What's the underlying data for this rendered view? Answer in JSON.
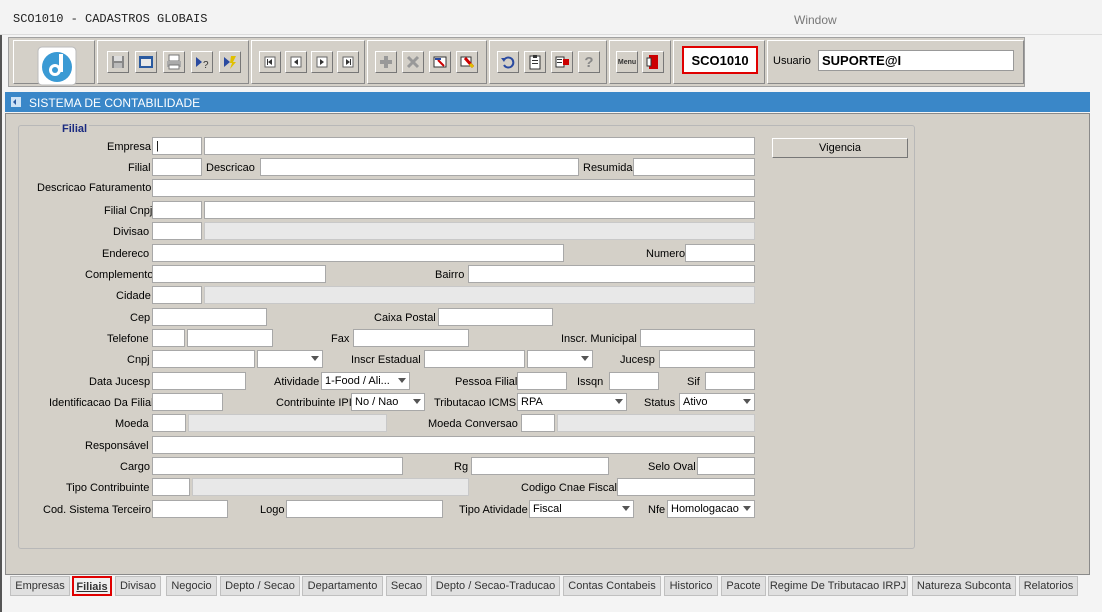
{
  "window": {
    "title": "SCO1010 - CADASTROS GLOBAIS",
    "menu": "Window"
  },
  "toolbar": {
    "module_code": "SCO1010",
    "user_label": "Usuario",
    "user_value": "SUPORTE@I",
    "icons": [
      "save-icon",
      "window-icon",
      "print-icon",
      "query-icon",
      "execute-query-icon",
      "first-record-icon",
      "previous-record-icon",
      "next-record-icon",
      "last-record-icon",
      "insert-record-icon",
      "delete-record-icon",
      "edit-record-icon",
      "clear-record-icon",
      "undo-icon",
      "clipboard-icon",
      "list-values-icon",
      "help-icon",
      "menu-icon",
      "exit-icon"
    ],
    "help_glyph": "?",
    "menu_glyph": "Menu"
  },
  "header": {
    "title": "SISTEMA DE CONTABILIDADE"
  },
  "form": {
    "section": "Filial",
    "labels": {
      "empresa": "Empresa",
      "filial": "Filial",
      "descricao": "Descricao",
      "resumida": "Resumida",
      "descricao_faturamento": "Descricao Faturamento",
      "filial_cnpj": "Filial Cnpj",
      "divisao": "Divisao",
      "endereco": "Endereco",
      "numero": "Numero",
      "complemento": "Complemento",
      "bairro": "Bairro",
      "cidade": "Cidade",
      "cep": "Cep",
      "caixa_postal": "Caixa Postal",
      "telefone": "Telefone",
      "fax": "Fax",
      "inscr_municipal": "Inscr. Municipal",
      "cnpj": "Cnpj",
      "inscr_estadual": "Inscr Estadual",
      "jucesp": "Jucesp",
      "data_jucesp": "Data Jucesp",
      "atividade": "Atividade",
      "pessoa_filial": "Pessoa Filial",
      "issqn": "Issqn",
      "sif": "Sif",
      "identificacao_filial": "Identificacao Da Filial",
      "contribuinte_ipi": "Contribuinte IPI",
      "tributacao_icms": "Tributacao ICMS",
      "status": "Status",
      "moeda": "Moeda",
      "moeda_conversao": "Moeda Conversao",
      "responsavel": "Responsável",
      "cargo": "Cargo",
      "rg": "Rg",
      "selo_oval": "Selo Oval",
      "tipo_contribuinte": "Tipo Contribuinte",
      "codigo_cnae_fiscal": "Codigo Cnae Fiscal",
      "cod_sistema_terceiro": "Cod. Sistema Terceiro",
      "logo": "Logo",
      "tipo_atividade": "Tipo Atividade",
      "nfe": "Nfe"
    },
    "values": {
      "atividade": "1-Food / Ali...",
      "contribuinte_ipi": "No / Nao",
      "tributacao_icms": "RPA",
      "status": "Ativo",
      "tipo_atividade": "Fiscal",
      "nfe": "Homologacao"
    },
    "vigencia_button": "Vigencia"
  },
  "tabs": [
    "Empresas",
    "Filiais",
    "Divisao",
    "Negocio",
    "Depto / Secao",
    "Departamento",
    "Secao",
    "Depto / Secao-Traducao",
    "Contas Contabeis",
    "Historico",
    "Pacote",
    "Regime De Tributacao IRPJ",
    "Natureza Subconta",
    "Relatorios"
  ],
  "active_tab": "Filiais",
  "colors": {
    "header_bar": "#3a87c8",
    "highlight": "#e00000",
    "panel": "#d4d0c8",
    "legend": "#1a2a80"
  }
}
